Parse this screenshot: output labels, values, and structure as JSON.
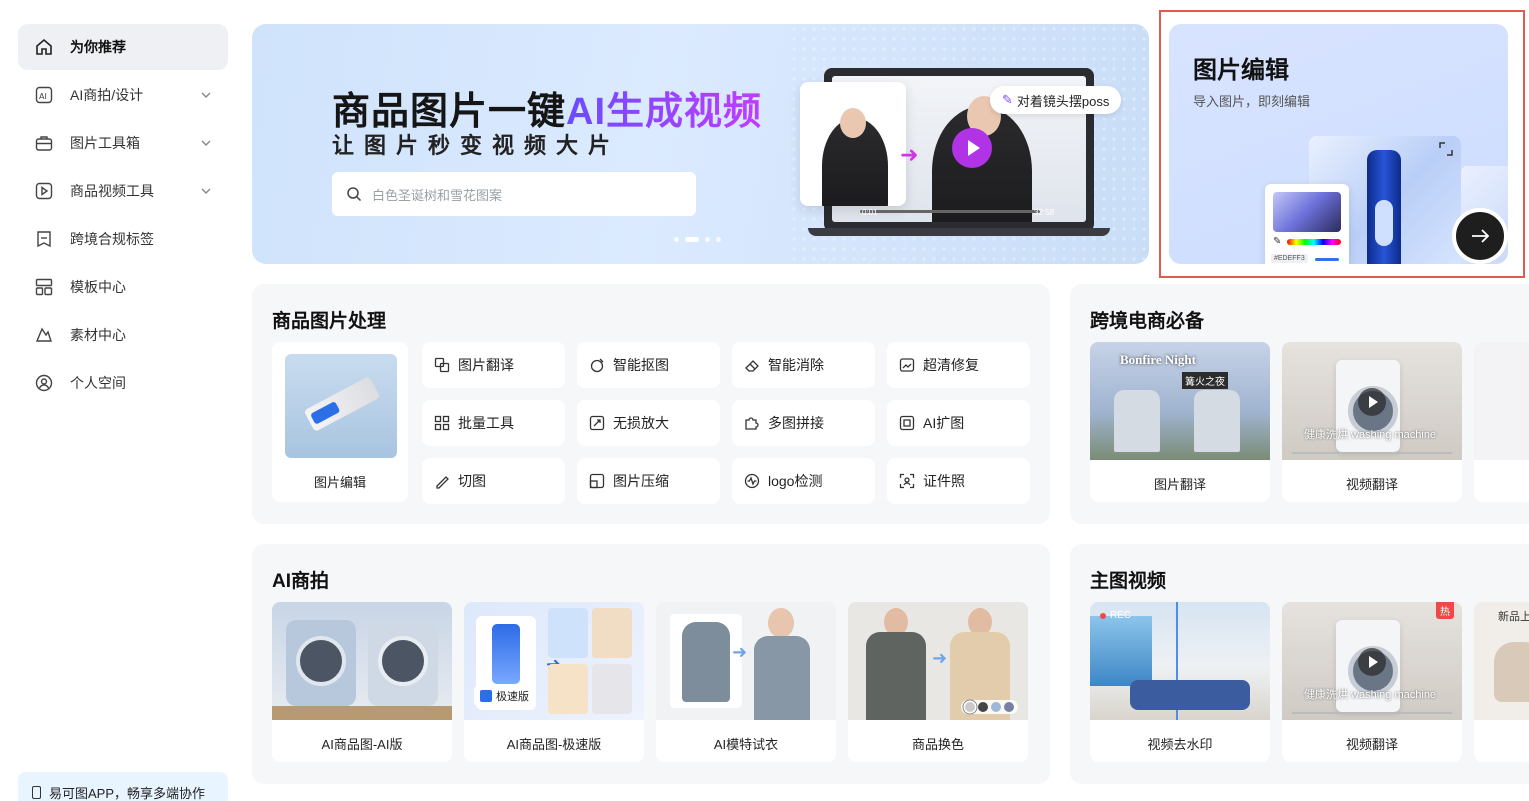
{
  "sidebar": {
    "items": [
      {
        "label": "为你推荐",
        "icon": "home-icon",
        "active": true,
        "expandable": false
      },
      {
        "label": "AI商拍/设计",
        "icon": "ai-icon",
        "active": false,
        "expandable": true
      },
      {
        "label": "图片工具箱",
        "icon": "toolbox-icon",
        "active": false,
        "expandable": true
      },
      {
        "label": "商品视频工具",
        "icon": "video-icon",
        "active": false,
        "expandable": true
      },
      {
        "label": "跨境合规标签",
        "icon": "tag-icon",
        "active": false,
        "expandable": false
      },
      {
        "label": "模板中心",
        "icon": "template-icon",
        "active": false,
        "expandable": false
      },
      {
        "label": "素材中心",
        "icon": "material-icon",
        "active": false,
        "expandable": false
      },
      {
        "label": "个人空间",
        "icon": "user-icon",
        "active": false,
        "expandable": false
      }
    ],
    "app_banner": "易可图APP，畅享多端协作"
  },
  "hero": {
    "title_prefix": "商品图片一键",
    "title_highlight": "AI生成视频",
    "subtitle": "让图片秒变视频大片",
    "search_placeholder": "白色圣诞树和雪花图案",
    "tag": "对着镜头摆poss",
    "time_start": "0:01",
    "time_end": "32:58"
  },
  "edit_card": {
    "title": "图片编辑",
    "subtitle": "导入图片，即刻编辑",
    "hex": "#EDEFF3"
  },
  "product_processing": {
    "title": "商品图片处理",
    "featured": "图片编辑",
    "tools": [
      {
        "label": "图片翻译",
        "icon": "translate-icon"
      },
      {
        "label": "智能抠图",
        "icon": "cutout-icon"
      },
      {
        "label": "智能消除",
        "icon": "eraser-icon"
      },
      {
        "label": "超清修复",
        "icon": "hd-icon"
      },
      {
        "label": "批量工具",
        "icon": "batch-icon"
      },
      {
        "label": "无损放大",
        "icon": "upscale-icon"
      },
      {
        "label": "多图拼接",
        "icon": "puzzle-icon"
      },
      {
        "label": "AI扩图",
        "icon": "expand-icon"
      },
      {
        "label": "切图",
        "icon": "slice-icon"
      },
      {
        "label": "图片压缩",
        "icon": "compress-icon"
      },
      {
        "label": "logo检测",
        "icon": "logo-detect-icon"
      },
      {
        "label": "证件照",
        "icon": "id-photo-icon"
      }
    ]
  },
  "cross_border": {
    "title": "跨境电商必备",
    "cards": [
      {
        "label": "图片翻译",
        "overlay_title": "Bonfire Night",
        "overlay_sub": "篝火之夜"
      },
      {
        "label": "视频翻译",
        "overlay_text": "健康洗烘 washing machine"
      }
    ]
  },
  "ai_shoot": {
    "title": "AI商拍",
    "cards": [
      {
        "label": "AI商品图-AI版"
      },
      {
        "label": "AI商品图-极速版",
        "badge": "极速版"
      },
      {
        "label": "AI模特试衣"
      },
      {
        "label": "商品换色"
      }
    ],
    "swatch_colors": [
      "#c9c9c9",
      "#444444",
      "#9fb7d8",
      "#7a7fa6"
    ]
  },
  "main_video": {
    "title": "主图视频",
    "cards": [
      {
        "label": "视频去水印",
        "rec": "REC"
      },
      {
        "label": "视频翻译",
        "overlay_text": "健康洗烘 washing machine",
        "badge": "热"
      }
    ],
    "partial_card_text": "新品上"
  },
  "colors": {
    "accent_purple": "#b033e6",
    "highlight_frame": "#e05a4f",
    "panel_bg": "#f6f7f9"
  }
}
